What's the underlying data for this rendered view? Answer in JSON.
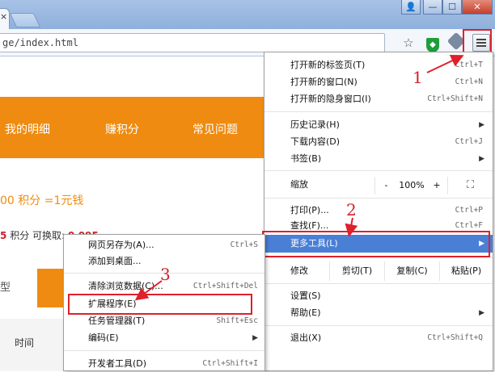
{
  "browser": {
    "tab_close": "×",
    "address": "ge/index.html",
    "window_buttons": {
      "user": "👤",
      "minimize": "—",
      "maximize": "☐",
      "close": "✕"
    }
  },
  "page": {
    "nav": [
      "我的明细",
      "赚积分",
      "常见问题"
    ],
    "points_line": "00 积分 =1元钱",
    "exchange_line_prefix": "5",
    "exchange_line": "积分  可换取:",
    "exchange_value": "0.095",
    "exchange_value2": "0.00",
    "side_label": "型",
    "table_header": "时间"
  },
  "annotations": {
    "n1": "1",
    "n2": "2",
    "n3": "3"
  },
  "main_menu": {
    "new_tab": {
      "label": "打开新的标签页(T)",
      "shortcut": "Ctrl+T"
    },
    "new_window": {
      "label": "打开新的窗口(N)",
      "shortcut": "Ctrl+N"
    },
    "incognito": {
      "label": "打开新的隐身窗口(I)",
      "shortcut": "Ctrl+Shift+N"
    },
    "history": {
      "label": "历史记录(H)"
    },
    "downloads": {
      "label": "下载内容(D)",
      "shortcut": "Ctrl+J"
    },
    "bookmarks": {
      "label": "书签(B)"
    },
    "zoom": {
      "label": "缩放",
      "minus": "-",
      "value": "100%",
      "plus": "+",
      "fullscreen": "⛶"
    },
    "print": {
      "label": "打印(P)...",
      "shortcut": "Ctrl+P"
    },
    "find": {
      "label": "查找(F)...",
      "shortcut": "Ctrl+F"
    },
    "more_tools": {
      "label": "更多工具(L)"
    },
    "edit": {
      "label": "修改",
      "cut": "剪切(T)",
      "copy": "复制(C)",
      "paste": "粘贴(P)"
    },
    "settings": {
      "label": "设置(S)"
    },
    "help": {
      "label": "帮助(E)"
    },
    "exit": {
      "label": "退出(X)",
      "shortcut": "Ctrl+Shift+Q"
    }
  },
  "sub_menu": {
    "save_as": {
      "label": "网页另存为(A)...",
      "shortcut": "Ctrl+S"
    },
    "add_desktop": {
      "label": "添加到桌面..."
    },
    "clear_data": {
      "label": "清除浏览数据(C)...",
      "shortcut": "Ctrl+Shift+Del"
    },
    "extensions": {
      "label": "扩展程序(E)"
    },
    "task_manager": {
      "label": "任务管理器(T)",
      "shortcut": "Shift+Esc"
    },
    "encoding": {
      "label": "编码(E)"
    },
    "dev_tools": {
      "label": "开发者工具(D)",
      "shortcut": "Ctrl+Shift+I"
    }
  },
  "colors": {
    "accent_orange": "#ef8b10",
    "highlight_blue": "#4a7fd6",
    "annotation_red": "#e0202a"
  }
}
